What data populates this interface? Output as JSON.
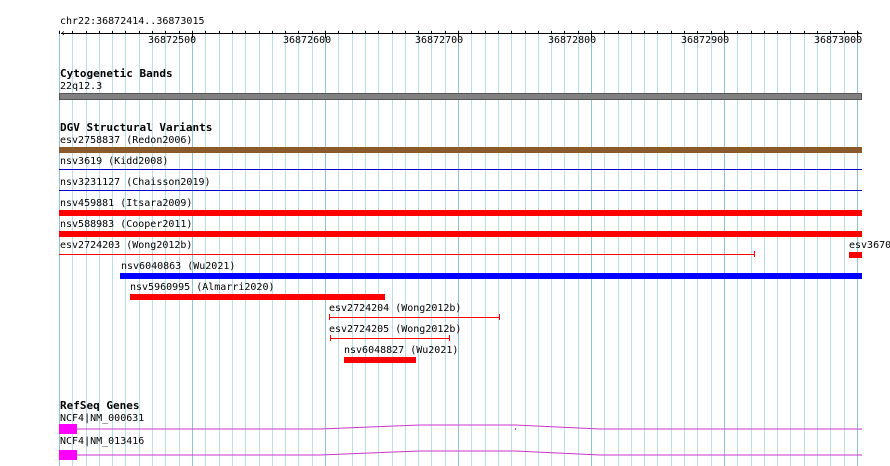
{
  "ruler": {
    "location": "chr22:36872414..36873015",
    "ticks": [
      "36872500",
      "36872600",
      "36872700",
      "36872800",
      "36872900",
      "36873000"
    ]
  },
  "tracks": {
    "cytoband": {
      "title": "Cytogenetic Bands",
      "band_label": "22q12.3",
      "color": "#808080"
    },
    "dgv": {
      "title": "DGV Structural Variants",
      "features": [
        {
          "label": "esv2758837 (Redon2006)",
          "color": "#8b5a2b",
          "style": "thick"
        },
        {
          "label": "nsv3619 (Kidd2008)",
          "color": "#0000cc",
          "style": "thin"
        },
        {
          "label": "nsv3231127 (Chaisson2019)",
          "color": "#0000cc",
          "style": "thin"
        },
        {
          "label": "nsv459881 (Itsara2009)",
          "color": "#ff0000",
          "style": "thick"
        },
        {
          "label": "nsv588983 (Cooper2011)",
          "color": "#ff0000",
          "style": "thick"
        },
        {
          "label": "esv2724203 (Wong2012b)",
          "color": "#ff0000",
          "style": "line"
        },
        {
          "label": "esv3670",
          "color": "#ff0000",
          "style": "thick"
        },
        {
          "label": "nsv6040863 (Wu2021)",
          "color": "#0000ff",
          "style": "thick"
        },
        {
          "label": "nsv5960995 (Almarri2020)",
          "color": "#ff0000",
          "style": "thick"
        },
        {
          "label": "esv2724204 (Wong2012b)",
          "color": "#ff0000",
          "style": "line"
        },
        {
          "label": "esv2724205 (Wong2012b)",
          "color": "#ff0000",
          "style": "line"
        },
        {
          "label": "nsv6048827 (Wu2021)",
          "color": "#ff0000",
          "style": "thick"
        }
      ]
    },
    "refseq": {
      "title": "RefSeq Genes",
      "color": "#cc33cc",
      "genes": [
        {
          "label": "NCF4|NM_000631"
        },
        {
          "label": "NCF4|NM_013416"
        }
      ]
    }
  }
}
